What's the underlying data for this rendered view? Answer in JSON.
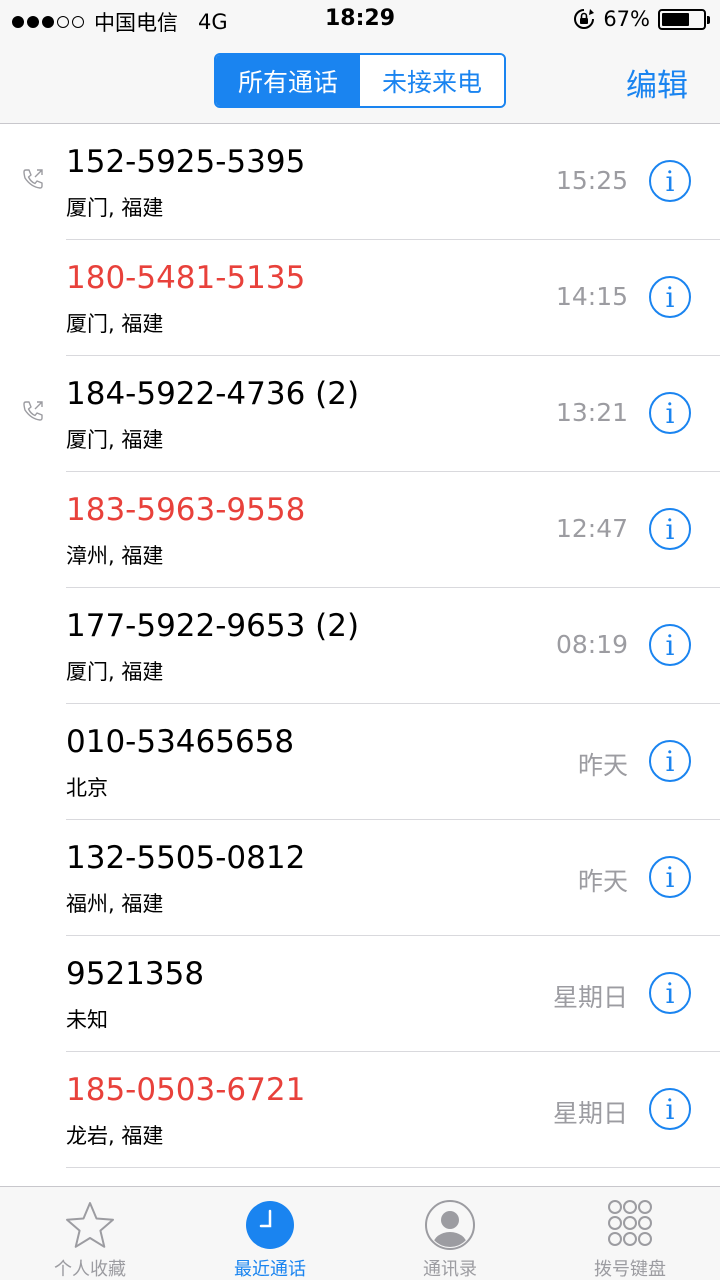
{
  "status_bar": {
    "carrier": "中国电信",
    "network": "4G",
    "time": "18:29",
    "battery": "67%",
    "battery_level": 0.67
  },
  "nav": {
    "segments": [
      "所有通话",
      "未接来电"
    ],
    "active_segment": 0,
    "edit_label": "编辑"
  },
  "calls": [
    {
      "number": "152-5925-5395",
      "location": "厦门, 福建",
      "time": "15:25",
      "missed": false,
      "outgoing": true
    },
    {
      "number": "180-5481-5135",
      "location": "厦门, 福建",
      "time": "14:15",
      "missed": true,
      "outgoing": false
    },
    {
      "number": "184-5922-4736 (2)",
      "location": "厦门, 福建",
      "time": "13:21",
      "missed": false,
      "outgoing": true
    },
    {
      "number": "183-5963-9558",
      "location": "漳州, 福建",
      "time": "12:47",
      "missed": true,
      "outgoing": false
    },
    {
      "number": "177-5922-9653 (2)",
      "location": "厦门, 福建",
      "time": "08:19",
      "missed": false,
      "outgoing": false
    },
    {
      "number": "010-53465658",
      "location": "北京",
      "time": "昨天",
      "missed": false,
      "outgoing": false
    },
    {
      "number": "132-5505-0812",
      "location": "福州, 福建",
      "time": "昨天",
      "missed": false,
      "outgoing": false
    },
    {
      "number": "9521358",
      "location": "未知",
      "time": "星期日",
      "missed": false,
      "outgoing": false
    },
    {
      "number": "185-0503-6721",
      "location": "龙岩, 福建",
      "time": "星期日",
      "missed": true,
      "outgoing": false
    }
  ],
  "tabs": [
    {
      "label": "个人收藏",
      "icon": "star-icon"
    },
    {
      "label": "最近通话",
      "icon": "clock-icon",
      "active": true
    },
    {
      "label": "通讯录",
      "icon": "contact-icon"
    },
    {
      "label": "拨号键盘",
      "icon": "keypad-icon"
    }
  ],
  "colors": {
    "accent": "#1a84f0",
    "missed": "#e8413b",
    "secondary_text": "#9c9ca1"
  }
}
